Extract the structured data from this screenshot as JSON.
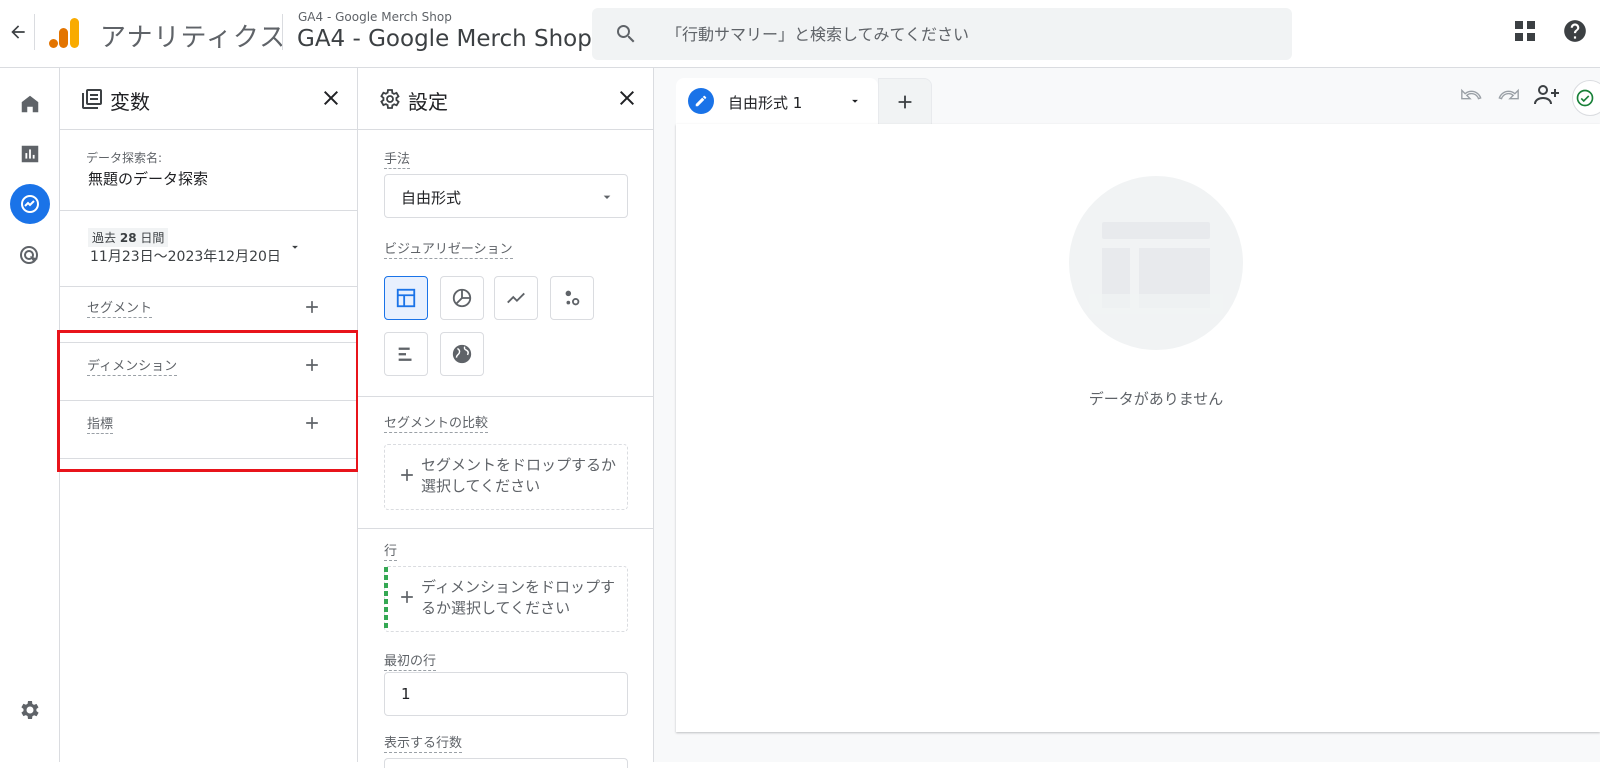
{
  "header": {
    "app_title": "アナリティクス",
    "property_sub": "GA4 - Google Merch Shop",
    "property_main": "GA4 - Google Merch Shop",
    "search_placeholder": "「行動サマリー」と検索してみてください"
  },
  "variables_panel": {
    "title": "変数",
    "explore_name_label": "データ探索名:",
    "explore_name": "無題のデータ探索",
    "date_chip_prefix": "過去",
    "date_chip_number": "28",
    "date_chip_suffix": "日間",
    "date_range": "11月23日～2023年12月20日",
    "segments_label": "セグメント",
    "dimensions_label": "ディメンション",
    "metrics_label": "指標"
  },
  "settings_panel": {
    "title": "設定",
    "technique_label": "手法",
    "technique_value": "自由形式",
    "visualization_label": "ビジュアリゼーション",
    "segment_compare_label": "セグメントの比較",
    "segment_drop_text": "セグメントをドロップするか選択してください",
    "rows_label": "行",
    "rows_drop_text": "ディメンションをドロップするか選択してください",
    "first_row_label": "最初の行",
    "first_row_value": "1",
    "show_rows_label": "表示する行数"
  },
  "canvas": {
    "tab_label": "自由形式 1",
    "empty_text": "データがありません"
  },
  "colors": {
    "accent": "#1a73e8",
    "highlight": "#e8141b",
    "logo_orange": "#f9ab00",
    "logo_dark": "#e37400"
  }
}
